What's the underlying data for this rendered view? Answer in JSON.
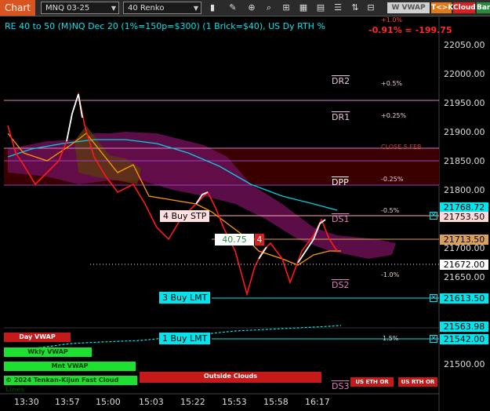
{
  "toolbar": {
    "chart_tab": "Chart",
    "instrument": "MNQ 03-25",
    "bar_type": "40 Renko",
    "buttons": {
      "w_vwap": "W VWAP",
      "tk": "T<>K",
      "cloud": "Cloud",
      "bar": "Bar"
    },
    "icons": [
      "instrument-dropdown-icon",
      "bartype-dropdown-icon",
      "bar-style-icon",
      "drawing-tool-icon",
      "zoom-icon",
      "strategy-icon",
      "indicator-icon",
      "template-icon",
      "properties-icon",
      "data-box-icon",
      "trade-icon",
      "chart-trader-icon"
    ]
  },
  "chart_title": "RE 40 to 50 (M)NQ Dec 20 (1%=150p=$300) (1 Brick=$40), US Dy RTH %",
  "header_pct": "+1.0%",
  "header_pnl": "-0.91% = -199.75",
  "price_axis": {
    "ticks": [
      "22050.00",
      "22000.00",
      "21950.00",
      "21900.00",
      "21850.00",
      "21800.00",
      "21700.00",
      "21650.00",
      "21500.00"
    ],
    "boxes": [
      {
        "label": "21768.72",
        "bg": "#00e5ee"
      },
      {
        "label": "21753.50",
        "bg": "#ffd9d9"
      },
      {
        "label": "21713.50",
        "bg": "#d9a05a"
      },
      {
        "label": "21672.00",
        "bg": "#ffffff"
      },
      {
        "label": "21613.50",
        "bg": "#00e5ee"
      },
      {
        "label": "21563.98",
        "bg": "#00e5ee"
      },
      {
        "label": "21542.00",
        "bg": "#00e5ee"
      }
    ]
  },
  "time_axis": [
    "13:30",
    "13:57",
    "15:00",
    "15:03",
    "15:22",
    "15:53",
    "15:58",
    "16:17"
  ],
  "levels": [
    {
      "name": "DR2",
      "pct": "+0.5%"
    },
    {
      "name": "DR1",
      "pct": "+0.25%"
    },
    {
      "name": "",
      "pct": "CLOSE 5 FEB"
    },
    {
      "name": "DPP",
      "pct": "-0.25%"
    },
    {
      "name": "DS1",
      "pct": "-0.5%"
    },
    {
      "name": "DS2",
      "pct": "-1.0%"
    },
    {
      "name": "",
      "pct": "1.5%"
    },
    {
      "name": "DS3",
      "pct": ""
    }
  ],
  "orders": {
    "stop": {
      "label": "4 Buy STP"
    },
    "position": {
      "price": "40.75",
      "qty": "4"
    },
    "limit3": {
      "label": "3 Buy LMT"
    },
    "limit1": {
      "label": "1 Buy LMT"
    },
    "close_x": "✕"
  },
  "pane": {
    "day_vwap": "Day VWAP",
    "wkly_vwap": "Wkly VWAP",
    "mnt_vwap": "Mnt VWAP",
    "footer": "© 2024 Tenkan-Kijun Fast Cloud Lines",
    "outside_clouds": "Outside Clouds",
    "us_eth_or": "US ETH OR",
    "us_rth_or": "US RTH OR"
  },
  "colors": {
    "accent": "#d9541e",
    "cyan": "#00e5ee",
    "down": "#ff1a1a",
    "up": "#ffffff",
    "vwap": "#ff9900",
    "cloud_magenta": "#8b1a6b",
    "level_pink": "#e080c0"
  }
}
